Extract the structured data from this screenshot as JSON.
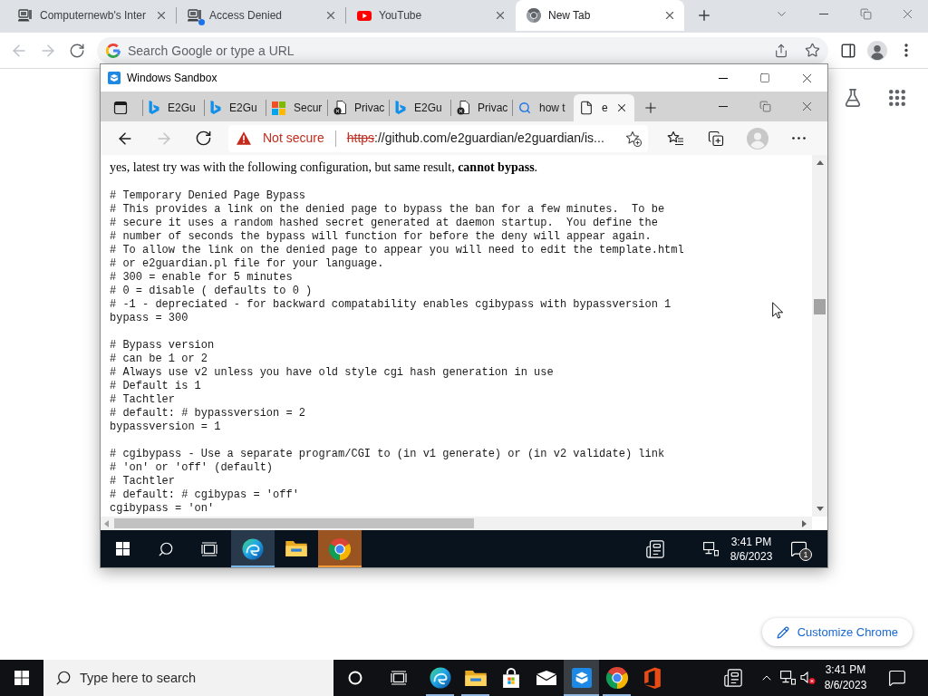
{
  "browser": {
    "tabs": [
      {
        "title": "Computernewb's Inter",
        "selected": false,
        "attention": false
      },
      {
        "title": "Access Denied",
        "selected": false,
        "attention": true
      },
      {
        "title": "YouTube",
        "selected": false,
        "attention": false
      },
      {
        "title": "New Tab",
        "selected": true,
        "attention": false
      }
    ],
    "nav": {
      "back_disabled": true,
      "forward_disabled": true
    },
    "omnibox": {
      "placeholder": "Search Google or type a URL"
    },
    "customize_button": "Customize Chrome"
  },
  "sandbox_window": {
    "title": "Windows Sandbox",
    "edge": {
      "tabs": [
        {
          "title": "E2Gu",
          "selected": false
        },
        {
          "title": "E2Gu",
          "selected": false
        },
        {
          "title": "Secur",
          "selected": false
        },
        {
          "title": "Privac",
          "selected": false
        },
        {
          "title": "E2Gu",
          "selected": false
        },
        {
          "title": "Privac",
          "selected": false
        },
        {
          "title": "how t",
          "selected": false
        },
        {
          "title": "e",
          "selected": true
        }
      ],
      "nav": {
        "back_disabled": false,
        "forward_disabled": true
      },
      "address": {
        "secure": false,
        "security_label": "Not secure",
        "scheme": "https",
        "rest": "://github.com/e2guardian/e2guardian/is..."
      },
      "page": {
        "intro": "yes, latest try was with the following configuration, but same result, **cannot bypass**.",
        "code_blocks": [
          [
            "# Temporary Denied Page Bypass",
            "# This provides a link on the denied page to bypass the ban for a few minutes.  To be",
            "# secure it uses a random hashed secret generated at daemon startup.  You define the",
            "# number of seconds the bypass will function for before the deny will appear again.",
            "# To allow the link on the denied page to appear you will need to edit the template.html",
            "# or e2guardian.pl file for your language.",
            "# 300 = enable for 5 minutes",
            "# 0 = disable ( defaults to 0 )",
            "# -1 - depreciated - for backward compatability enables cgibypass with bypassversion 1",
            "bypass = 300"
          ],
          [
            "# Bypass version",
            "# can be 1 or 2",
            "# Always use v2 unless you have old style cgi hash generation in use",
            "# Default is 1",
            "# Tachtler",
            "# default: # bypassversion = 2",
            "bypassversion = 1"
          ],
          [
            "# cgibypass - Use a separate program/CGI to (in v1 generate) or (in v2 validate) link",
            "# 'on' or 'off' (default)",
            "# Tachtler",
            "# default: # cgibypas = 'off'",
            "cgibypass = 'on'"
          ]
        ]
      }
    },
    "taskbar": {
      "apps": [
        {
          "selected": true,
          "attention": false
        },
        {
          "selected": false,
          "attention": false
        },
        {
          "selected": false,
          "attention": true
        }
      ],
      "clock": {
        "time": "3:41 PM",
        "date": "8/6/2023"
      },
      "notification_count": "1"
    }
  },
  "taskbar": {
    "search": {
      "placeholder": "Type here to search"
    },
    "apps": [
      {
        "running": true,
        "selected": false
      },
      {
        "running": true,
        "selected": false
      },
      {
        "running": false,
        "selected": false
      },
      {
        "running": false,
        "selected": false
      },
      {
        "running": true,
        "selected": true
      },
      {
        "running": true,
        "selected": false
      },
      {
        "running": false,
        "selected": false
      }
    ],
    "clock": {
      "time": "3:41 PM",
      "date": "8/6/2023"
    }
  }
}
